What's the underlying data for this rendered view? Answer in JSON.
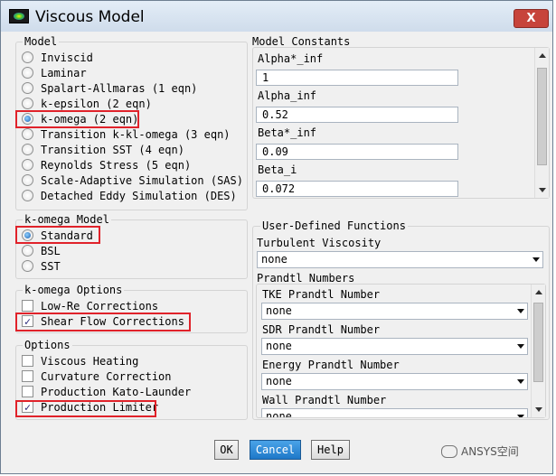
{
  "window": {
    "title": "Viscous Model",
    "close_label": "X"
  },
  "model": {
    "label": "Model",
    "options": [
      {
        "label": "Inviscid",
        "selected": false
      },
      {
        "label": "Laminar",
        "selected": false
      },
      {
        "label": "Spalart-Allmaras (1 eqn)",
        "selected": false
      },
      {
        "label": "k-epsilon (2 eqn)",
        "selected": false
      },
      {
        "label": "k-omega (2 eqn)",
        "selected": true
      },
      {
        "label": "Transition k-kl-omega (3 eqn)",
        "selected": false
      },
      {
        "label": "Transition SST (4 eqn)",
        "selected": false
      },
      {
        "label": "Reynolds Stress (5 eqn)",
        "selected": false
      },
      {
        "label": "Scale-Adaptive Simulation (SAS)",
        "selected": false
      },
      {
        "label": "Detached Eddy Simulation (DES)",
        "selected": false
      }
    ]
  },
  "komega_model": {
    "label": "k-omega Model",
    "options": [
      {
        "label": "Standard",
        "selected": true
      },
      {
        "label": "BSL",
        "selected": false
      },
      {
        "label": "SST",
        "selected": false
      }
    ]
  },
  "komega_options": {
    "label": "k-omega Options",
    "options": [
      {
        "label": "Low-Re Corrections",
        "checked": false
      },
      {
        "label": "Shear Flow Corrections",
        "checked": true
      }
    ]
  },
  "options": {
    "label": "Options",
    "options": [
      {
        "label": "Viscous Heating",
        "checked": false
      },
      {
        "label": "Curvature Correction",
        "checked": false
      },
      {
        "label": "Production Kato-Launder",
        "checked": false
      },
      {
        "label": "Production Limiter",
        "checked": true
      }
    ]
  },
  "model_constants": {
    "label": "Model Constants",
    "items": [
      {
        "label": "Alpha*_inf",
        "value": "1"
      },
      {
        "label": "Alpha_inf",
        "value": "0.52"
      },
      {
        "label": "Beta*_inf",
        "value": "0.09"
      },
      {
        "label": "Beta_i",
        "value": "0.072"
      }
    ]
  },
  "udf": {
    "label": "User-Defined Functions",
    "turbulent_viscosity_label": "Turbulent Viscosity",
    "turbulent_viscosity_value": "none",
    "prandtl_label": "Prandtl Numbers",
    "prandtl_items": [
      {
        "label": "TKE Prandtl Number",
        "value": "none"
      },
      {
        "label": "SDR Prandtl Number",
        "value": "none"
      },
      {
        "label": "Energy Prandtl Number",
        "value": "none"
      },
      {
        "label": "Wall Prandtl Number",
        "value": "none"
      }
    ]
  },
  "buttons": {
    "ok": "OK",
    "cancel": "Cancel",
    "help": "Help"
  },
  "watermark": "ANSYS空间",
  "colors": {
    "highlight": "#e0222a",
    "accent_button": "#1e78c8"
  }
}
